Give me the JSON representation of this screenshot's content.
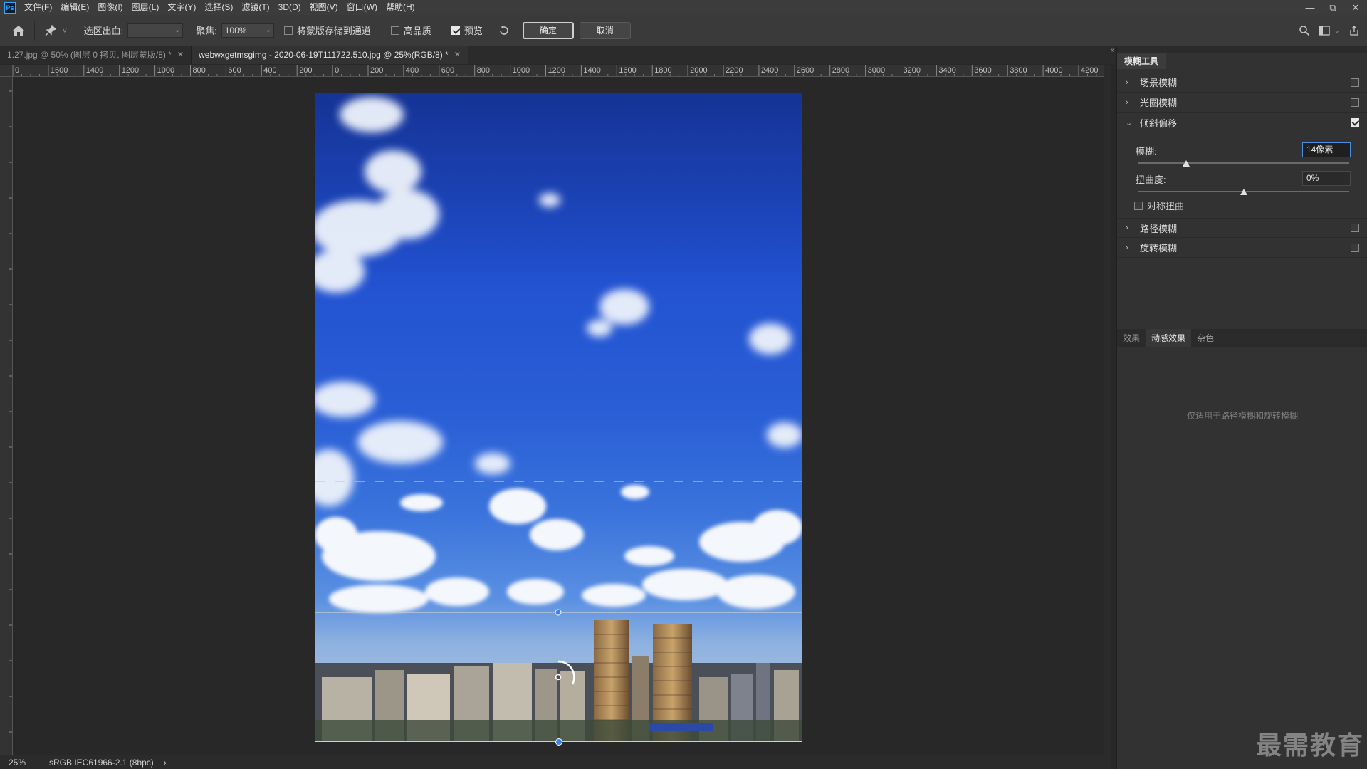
{
  "menubar": {
    "items": [
      "文件(F)",
      "编辑(E)",
      "图像(I)",
      "图层(L)",
      "文字(Y)",
      "选择(S)",
      "滤镜(T)",
      "3D(D)",
      "视图(V)",
      "窗口(W)",
      "帮助(H)"
    ],
    "logo": "Ps"
  },
  "optbar": {
    "selection_output_label": "选区出血:",
    "focus_label": "聚焦:",
    "focus_value": "100%",
    "save_mask_label": "将蒙版存储到通道",
    "high_quality_label": "高品质",
    "preview_label": "预览",
    "ok_label": "确定",
    "cancel_label": "取消"
  },
  "tabs": [
    {
      "label": "1.27.jpg @ 50% (图层 0 拷贝, 图层蒙版/8) *",
      "active": false
    },
    {
      "label": "webwxgetmsgimg - 2020-06-19T111722.510.jpg @ 25%(RGB/8) *",
      "active": true
    }
  ],
  "ruler": {
    "h_labels": [
      "0",
      "1600",
      "1400",
      "1200",
      "1000",
      "800",
      "600",
      "400",
      "200",
      "0",
      "200",
      "400",
      "600",
      "800",
      "1000",
      "1200",
      "1400",
      "1600",
      "1800",
      "2000",
      "2200",
      "2400",
      "2600",
      "2800",
      "3000",
      "3200",
      "3400",
      "3600",
      "3800",
      "4000",
      "4200",
      "4"
    ]
  },
  "status": {
    "zoom": "25%",
    "profile": "sRGB IEC61966-2.1 (8bpc)",
    "arrow": "›"
  },
  "panel": {
    "title": "模糊工具",
    "rows": [
      {
        "label": "场景模糊",
        "checked": false,
        "expanded": false
      },
      {
        "label": "光圈模糊",
        "checked": false,
        "expanded": false
      },
      {
        "label": "倾斜偏移",
        "checked": true,
        "expanded": true
      },
      {
        "label": "路径模糊",
        "checked": false,
        "expanded": false
      },
      {
        "label": "旋转模糊",
        "checked": false,
        "expanded": false
      }
    ],
    "blur_label": "模糊:",
    "blur_value": "14像素",
    "distortion_label": "扭曲度:",
    "distortion_value": "0%",
    "symmetric_label": "对称扭曲",
    "bottom_tabs": [
      "效果",
      "动感效果",
      "杂色"
    ],
    "active_bottom_tab": "动感效果",
    "hint": "仅适用于路径模糊和旋转模糊"
  },
  "watermark": "最需教育",
  "colors": {
    "accent": "#4a90e2",
    "pin": "#3b82f6"
  }
}
